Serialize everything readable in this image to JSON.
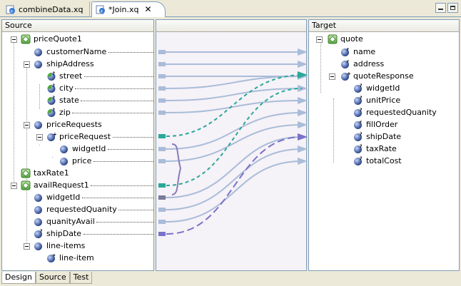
{
  "tabs": [
    {
      "label": "combineData.xq",
      "icon": "xquery-file-icon"
    },
    {
      "label": "*Join.xq",
      "icon": "xquery-file-icon",
      "close": "✕"
    }
  ],
  "panels": {
    "source": "Source",
    "target": "Target"
  },
  "source": {
    "priceQuote1": "priceQuote1",
    "customerName": "customerName",
    "shipAddress": "shipAddress",
    "street": "street",
    "city": "city",
    "state": "state",
    "zip": "zip",
    "priceRequests": "priceRequests",
    "priceRequest": "priceRequest",
    "widgetId": "widgetId",
    "price": "price",
    "taxRate1": "taxRate1",
    "availRequest1": "availRequest1",
    "widgetId2": "widgetId",
    "requestedQuanity": "requestedQuanity",
    "quanityAvail": "quanityAvail",
    "shipDate": "shipDate",
    "lineItems": "line-items",
    "lineItem": "line-item"
  },
  "target": {
    "quote": "quote",
    "name": "name",
    "address": "address",
    "quoteResponse": "quoteResponse",
    "widgetId": "widgetId",
    "unitPrice": "unitPrice",
    "requestedQuanity": "requestedQuanity",
    "fillOrder": "fillOrder",
    "shipDate": "shipDate",
    "taxRate": "taxRate",
    "totalCost": "totalCost"
  },
  "bottom_tabs": [
    "Design",
    "Source",
    "Test"
  ],
  "colors": {
    "solid_link": "#a9bcd8",
    "dashed_teal": "#2aa898",
    "dashed_purple": "#7a72c8",
    "brace": "#8a7ab8"
  }
}
